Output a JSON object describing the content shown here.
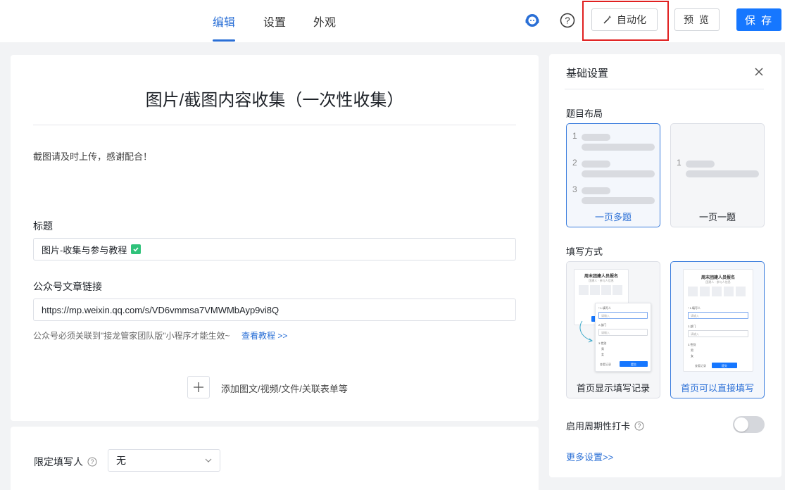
{
  "header": {
    "tabs": [
      {
        "label": "编辑",
        "active": true
      },
      {
        "label": "设置",
        "active": false
      },
      {
        "label": "外观",
        "active": false
      }
    ],
    "auto_label": "自动化",
    "preview_label": "预 览",
    "save_label": "保 存",
    "accent_color": "#1677ff",
    "highlight_color": "#e02020"
  },
  "form": {
    "title": "图片/截图内容收集（一次性收集）",
    "description": "截图请及时上传，感谢配合！",
    "fields": [
      {
        "label": "标题",
        "value": "图片-收集与参与教程"
      },
      {
        "label": "公众号文章链接",
        "value": "https://mp.weixin.qq.com/s/VD6vmmsa7VMWMbAyp9vi8Q"
      }
    ],
    "hint": "公众号必须关联到\"接龙管家团队版\"小程序才能生效~",
    "hint_link": "查看教程 >>",
    "add_label": "添加图文/视频/文件/关联表单等",
    "limit_label": "限定填写人",
    "limit_value": "无"
  },
  "panel": {
    "title": "基础设置",
    "layout_label": "题目布局",
    "layout_options": [
      {
        "label": "一页多题",
        "selected": true
      },
      {
        "label": "一页一题",
        "selected": false
      }
    ],
    "layout_numbers": [
      "1",
      "2",
      "3"
    ],
    "fill_label": "填写方式",
    "fill_options": [
      {
        "label": "首页显示填写记录",
        "selected": false
      },
      {
        "label": "首页可以直接填写",
        "selected": true
      }
    ],
    "mini_form": {
      "title": "周末团建人员报名",
      "subtitle": "团建人 · 参与人信息",
      "q1": "* 1.填写人",
      "q1_hint": "请输入",
      "q2": "2.部门",
      "q2_hint": "请输入",
      "q3": "3.性别",
      "opt_a": "男",
      "opt_b": "女",
      "btn_secondary": "查看记录",
      "btn_primary": "提交"
    },
    "periodic_label": "启用周期性打卡",
    "periodic_on": false,
    "more_label": "更多设置>>"
  }
}
